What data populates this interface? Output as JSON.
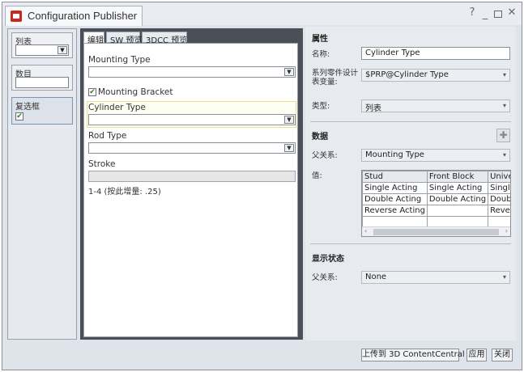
{
  "window": {
    "title": "Configuration Publisher",
    "controls": {
      "help": "?",
      "minimize": "_",
      "close": "✕"
    }
  },
  "sidebar": {
    "items": [
      {
        "label": "列表"
      },
      {
        "label": "数目"
      },
      {
        "label": "复选框"
      }
    ]
  },
  "center": {
    "tabs": [
      {
        "label": "编辑"
      },
      {
        "label": "SW 预览"
      },
      {
        "label": "3DCC 预览"
      }
    ],
    "fields": {
      "mounting_type": "Mounting Type",
      "mounting_bracket": "Mounting Bracket",
      "cylinder_type": "Cylinder Type",
      "rod_type": "Rod Type",
      "stroke": "Stroke",
      "stroke_hint": "1-4 (按此增量: .25)"
    }
  },
  "properties": {
    "header": "属性",
    "name_label": "名称:",
    "name_value": "Cylinder Type",
    "prp_label": "系列零件设计表变量:",
    "prp_value": "$PRP@Cylinder Type",
    "type_label": "类型:",
    "type_value": "列表"
  },
  "data_section": {
    "header": "数据",
    "parent_label": "父关系:",
    "parent_value": "Mounting Type",
    "value_label": "值:",
    "grid": {
      "columns": [
        "Stud",
        "Front Block",
        "Universa"
      ],
      "rows": [
        [
          "Single Acting",
          "Single Acting",
          "Single Ac"
        ],
        [
          "Double Acting",
          "Double Acting",
          "Double A"
        ],
        [
          "Reverse Acting",
          "",
          "Reverse"
        ],
        [
          "",
          "",
          ""
        ]
      ]
    }
  },
  "display_state": {
    "header": "显示状态",
    "parent_label": "父关系:",
    "parent_value": "None"
  },
  "footer": {
    "upload": "上传到 3D ContentCentral",
    "apply": "应用",
    "close": "关闭"
  }
}
